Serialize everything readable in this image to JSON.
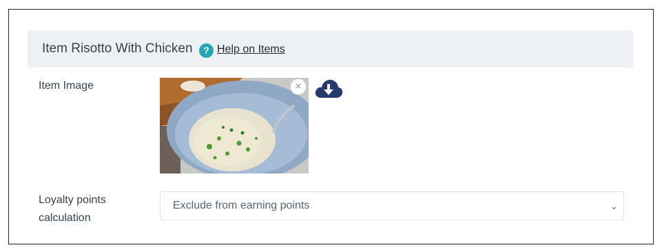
{
  "header": {
    "title": "Item Risotto With Chicken",
    "help_icon": "question-circle-icon",
    "help_glyph": "?",
    "help_link": "Help on Items"
  },
  "form": {
    "item_image": {
      "label": "Item Image",
      "image_alt": "Risotto with chicken on a blue plate",
      "remove_icon": "close-icon",
      "remove_glyph": "×",
      "download_icon": "cloud-download-icon"
    },
    "loyalty": {
      "label": "Loyalty points calculation",
      "selected": "Exclude from earning points",
      "chevron_icon": "chevron-down-icon",
      "chevron_glyph": "⌄"
    }
  },
  "colors": {
    "header_bg": "#edf1f4",
    "help_icon": "#23a8b3",
    "download_icon": "#243b6b",
    "border": "#222222"
  }
}
